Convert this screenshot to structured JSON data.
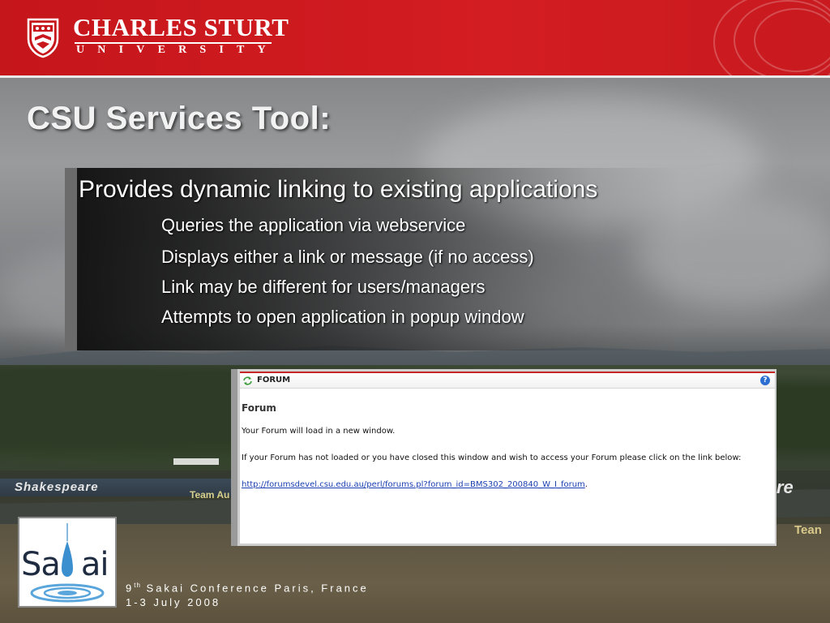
{
  "header": {
    "brand_name": "CHARLES STURT",
    "brand_sub": "UNIVERSITY",
    "accent_color": "#c8181e"
  },
  "slide": {
    "title": "CSU Services Tool:",
    "bullet_main": "Provides dynamic linking to existing applications",
    "sub_bullets": [
      "Queries the application via webservice",
      "Displays either a link or message (if no access)",
      "Link may be different for users/managers",
      "Attempts to open application in popup window"
    ]
  },
  "background": {
    "banner_left": "Shakespeare",
    "banner_mid": "Team Au",
    "banner_right": "re",
    "banner_team": "Tean"
  },
  "forum": {
    "bar_title": "FORUM",
    "help_glyph": "?",
    "heading": "Forum",
    "message1": "Your Forum will load in a new window.",
    "message2": "If your Forum has not loaded or you have closed this window and wish to access your Forum please click on the link below:",
    "link": "http://forumsdevel.csu.edu.au/perl/forums.pl?forum_id=BMS302_200840_W_I_forum",
    "link_suffix": "."
  },
  "sakai": {
    "word_left": "Sa",
    "word_right": "ai"
  },
  "footer": {
    "line1_num": "9",
    "line1_sup": "th",
    "line1_rest": " Sakai Conference Paris, France",
    "line2": "1-3 July 2008"
  }
}
